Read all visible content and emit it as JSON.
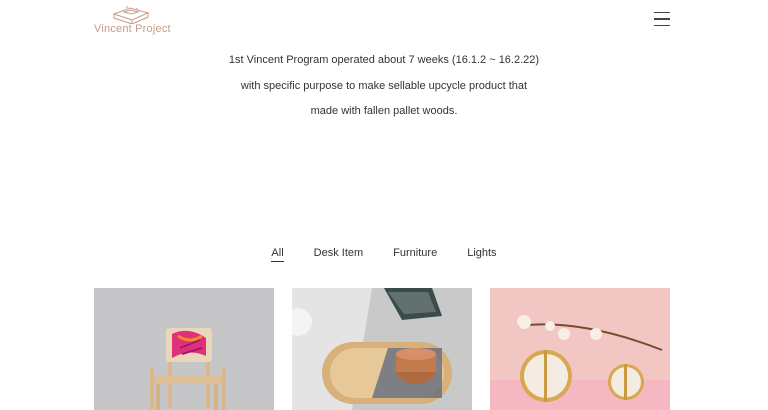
{
  "brand": {
    "name": "Vincent Project"
  },
  "nav": {
    "menu_icon": "hamburger-menu-icon"
  },
  "intro": {
    "lines": [
      "1st Vincent Program operated about 7 weeks (16.1.2 ~ 16.2.22)",
      "with specific purpose to make sellable upcycle product that",
      "made with fallen pallet woods."
    ]
  },
  "filters": {
    "active": "All",
    "items": [
      "All",
      "Desk Item",
      "Furniture",
      "Lights"
    ]
  },
  "colors": {
    "brand": "#c79a86",
    "text": "#333333",
    "background": "#ffffff"
  },
  "gallery": {
    "items": [
      {
        "icon": "chair-photo"
      },
      {
        "icon": "tray-photo"
      },
      {
        "icon": "mirror-photo"
      }
    ]
  }
}
